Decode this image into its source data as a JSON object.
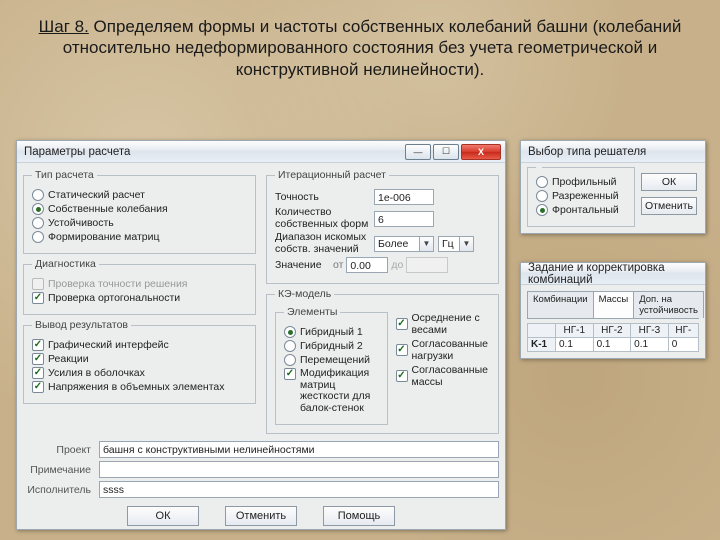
{
  "headline": {
    "step": "Шаг 8.",
    "text": " Определяем формы и частоты собственных колебаний башни (колебаний относительно недеформированного состояния без учета геометрической и конструктивной нелинейности)."
  },
  "main": {
    "title": "Параметры расчета",
    "groups": {
      "calc_type": {
        "legend": "Тип расчета",
        "options": {
          "static": "Статический расчет",
          "eigen": "Собственные колебания",
          "stability": "Устойчивость",
          "matrix": "Формирование матриц"
        },
        "selected": "eigen"
      },
      "iter": {
        "legend": "Итерационный расчет",
        "precision_label": "Точность",
        "precision_value": "1e-006",
        "count_label": "Количество собственных форм",
        "count_value": "6",
        "range_label": "Диапазон искомых собств. значений",
        "range_select": "Более",
        "range_unit": "Гц",
        "value_label": "Значение",
        "from_label": "от",
        "to_label": "до",
        "from_value": "0.00",
        "to_value": ""
      },
      "diag": {
        "legend": "Диагностика",
        "accuracy": "Проверка точности решения",
        "ortho": "Проверка ортогональности",
        "accuracy_checked": false,
        "ortho_checked": true
      },
      "output": {
        "legend": "Вывод результатов",
        "items": {
          "gui": "Графический интерфейс",
          "reactions": "Реакции",
          "shell": "Усилия в оболочках",
          "solid": "Напряжения в объемных элементах"
        }
      },
      "kemodel": {
        "legend": "КЭ-модель",
        "elements_legend": "Элементы",
        "elements": {
          "hyb1": "Гибридный 1",
          "hyb2": "Гибридный 2",
          "displ": "Перемещений"
        },
        "element_selected": "hyb1",
        "modify": "Модификация матриц жесткости для балок-стенок",
        "modify_checked": true,
        "right": {
          "avg": "Осреднение с весами",
          "loads": "Согласованные нагрузки",
          "mass": "Согласованные массы"
        }
      }
    },
    "project_label": "Проект",
    "project_value": "башня с конструктивными нелинейностями",
    "note_label": "Примечание",
    "note_value": "",
    "author_label": "Исполнитель",
    "author_value": "ssss",
    "buttons": {
      "ok": "ОК",
      "cancel": "Отменить",
      "help": "Помощь"
    }
  },
  "solver": {
    "title": "Выбор типа решателя",
    "options": {
      "profile": "Профильный",
      "sparse": "Разреженный",
      "frontal": "Фронтальный"
    },
    "selected": "frontal",
    "ok": "ОК",
    "cancel": "Отменить"
  },
  "comb": {
    "title": "Задание и корректировка комбинаций",
    "tabs": {
      "comb": "Комбинации",
      "mass": "Массы",
      "stab": "Доп. на устойчивость"
    },
    "active_tab": "mass",
    "headers": [
      "НГ-1",
      "НГ-2",
      "НГ-3",
      "НГ-"
    ],
    "rows": [
      {
        "name": "K-1",
        "vals": [
          "0.1",
          "0.1",
          "0.1",
          "0"
        ]
      }
    ]
  },
  "icons": {
    "min": "—",
    "max": "☐",
    "close": "X"
  }
}
